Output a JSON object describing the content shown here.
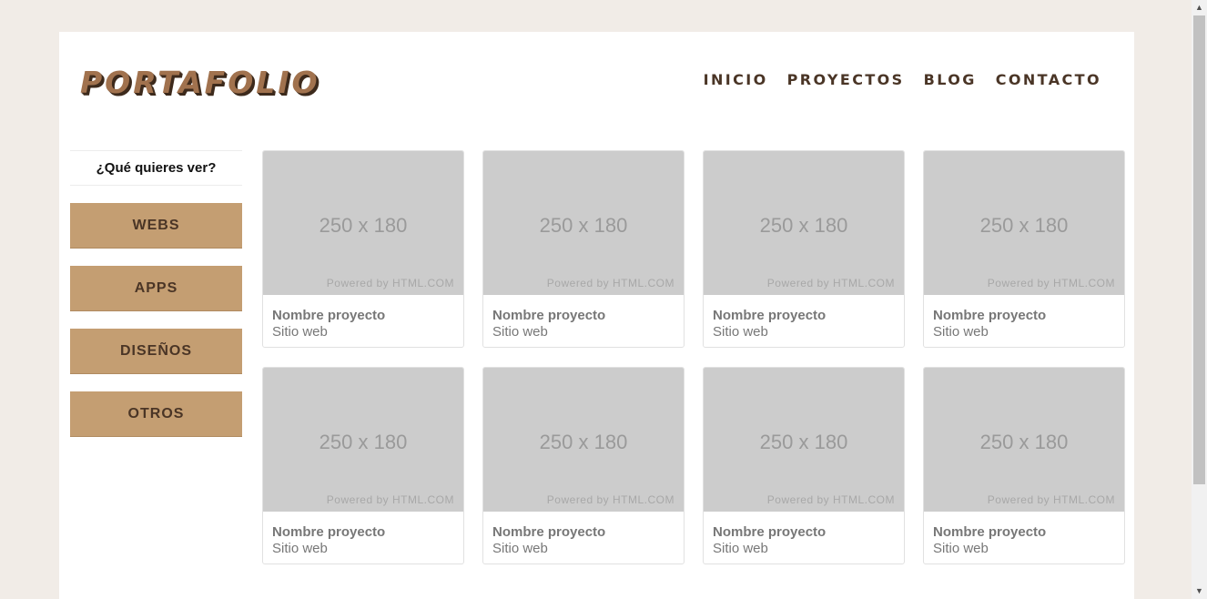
{
  "header": {
    "logo": "PORTAFOLIO",
    "nav": [
      "INICIO",
      "PROYECTOS",
      "BLOG",
      "CONTACTO"
    ]
  },
  "sidebar": {
    "question": "¿Qué quieres ver?",
    "filters": [
      "WEBS",
      "APPS",
      "DISEÑOS",
      "OTROS"
    ]
  },
  "projects": [
    {
      "placeholder": "250 x 180",
      "powered": "Powered by HTML.COM",
      "name": "Nombre proyecto",
      "type": "Sitio web"
    },
    {
      "placeholder": "250 x 180",
      "powered": "Powered by HTML.COM",
      "name": "Nombre proyecto",
      "type": "Sitio web"
    },
    {
      "placeholder": "250 x 180",
      "powered": "Powered by HTML.COM",
      "name": "Nombre proyecto",
      "type": "Sitio web"
    },
    {
      "placeholder": "250 x 180",
      "powered": "Powered by HTML.COM",
      "name": "Nombre proyecto",
      "type": "Sitio web"
    },
    {
      "placeholder": "250 x 180",
      "powered": "Powered by HTML.COM",
      "name": "Nombre proyecto",
      "type": "Sitio web"
    },
    {
      "placeholder": "250 x 180",
      "powered": "Powered by HTML.COM",
      "name": "Nombre proyecto",
      "type": "Sitio web"
    },
    {
      "placeholder": "250 x 180",
      "powered": "Powered by HTML.COM",
      "name": "Nombre proyecto",
      "type": "Sitio web"
    },
    {
      "placeholder": "250 x 180",
      "powered": "Powered by HTML.COM",
      "name": "Nombre proyecto",
      "type": "Sitio web"
    }
  ],
  "icons": {
    "scroll_up": "chevron-up-icon",
    "scroll_down": "chevron-down-icon"
  },
  "colors": {
    "background": "#f1ece7",
    "accent": "#c49e72",
    "text_dark": "#4a3526",
    "placeholder": "#cccccc"
  }
}
